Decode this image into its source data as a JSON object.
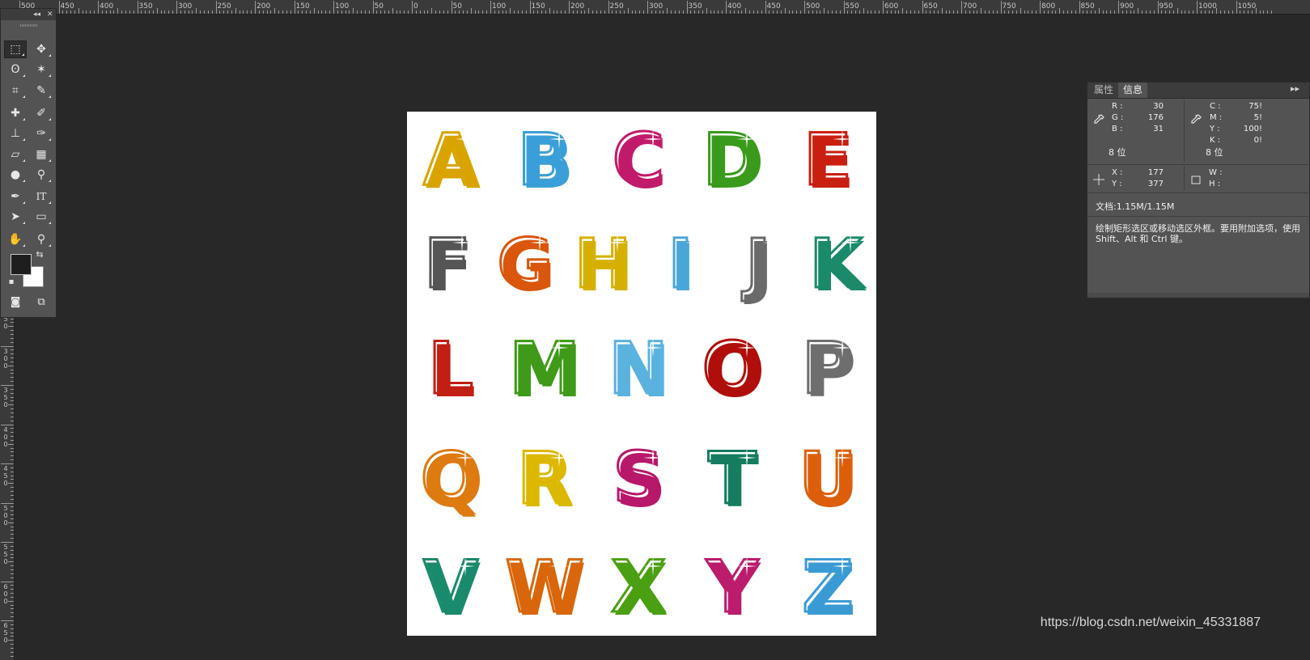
{
  "ruler_top": {
    "labels": [
      "500",
      "450",
      "400",
      "350",
      "300",
      "250",
      "200",
      "150",
      "100",
      "50",
      "0",
      "50",
      "100",
      "150",
      "200",
      "250",
      "300",
      "350",
      "400",
      "450",
      "500",
      "550",
      "600",
      "650",
      "700",
      "750",
      "800",
      "850",
      "900",
      "950",
      "1000",
      "1050"
    ]
  },
  "ruler_left": {
    "labels": [
      "250",
      "300",
      "350",
      "400",
      "450",
      "500",
      "550",
      "600",
      "650"
    ]
  },
  "toolbox": {
    "collapse_glyph": "◂◂",
    "close_glyph": "✕",
    "tools": [
      {
        "name": "rectangular-marquee-tool",
        "glyph": "⬚",
        "active": true
      },
      {
        "name": "move-tool",
        "glyph": "✥"
      },
      {
        "name": "lasso-tool",
        "glyph": "ʘ"
      },
      {
        "name": "magic-wand-tool",
        "glyph": "✶"
      },
      {
        "name": "crop-tool",
        "glyph": "⌗"
      },
      {
        "name": "eyedropper-tool",
        "glyph": "✎"
      },
      {
        "name": "healing-brush-tool",
        "glyph": "✚"
      },
      {
        "name": "brush-tool",
        "glyph": "✐"
      },
      {
        "name": "clone-stamp-tool",
        "glyph": "⊥"
      },
      {
        "name": "history-brush-tool",
        "glyph": "✑"
      },
      {
        "name": "eraser-tool",
        "glyph": "▱"
      },
      {
        "name": "gradient-tool",
        "glyph": "▦"
      },
      {
        "name": "blur-tool",
        "glyph": "●"
      },
      {
        "name": "dodge-tool",
        "glyph": "⚲"
      },
      {
        "name": "pen-tool",
        "glyph": "✒"
      },
      {
        "name": "type-tool",
        "glyph": "IT"
      },
      {
        "name": "path-selection-tool",
        "glyph": "➤"
      },
      {
        "name": "rectangle-tool",
        "glyph": "▭"
      },
      {
        "name": "hand-tool",
        "glyph": "✋"
      },
      {
        "name": "zoom-tool",
        "glyph": "⚲"
      }
    ],
    "foreground_color": "#1e1e1e",
    "background_color": "#ffffff",
    "swap_glyph": "⇆",
    "mask_glyph": "◙",
    "screen_mode_glyph": "⧉"
  },
  "canvas": {
    "background": "#ffffff",
    "letters": [
      {
        "char": "A",
        "c1": "#ffe600",
        "c2": "#f2c300",
        "c3": "#d9a400"
      },
      {
        "char": "B",
        "c1": "#bfe7ff",
        "c2": "#5cbdf0",
        "c3": "#3a9fd8"
      },
      {
        "char": "C",
        "c1": "#ff8fc4",
        "c2": "#e8358a",
        "c3": "#c21a6b"
      },
      {
        "char": "D",
        "c1": "#a7e85c",
        "c2": "#58c22a",
        "c3": "#3a9a1b"
      },
      {
        "char": "E",
        "c1": "#ff9a2e",
        "c2": "#ee3b1a",
        "c3": "#c91f10"
      },
      {
        "char": "F",
        "c1": "#e6e6e6",
        "c2": "#9a9a9a",
        "c3": "#555555"
      },
      {
        "char": "G",
        "c1": "#ffc23a",
        "c2": "#f08a1a",
        "c3": "#d9560c"
      },
      {
        "char": "H",
        "c1": "#fff26a",
        "c2": "#f5d600",
        "c3": "#d6b000"
      },
      {
        "char": "I",
        "c1": "#d6f0ff",
        "c2": "#7cc8f0",
        "c3": "#4aa6d8"
      },
      {
        "char": "J",
        "c1": "#e0e0e0",
        "c2": "#a6a6a6",
        "c3": "#6a6a6a"
      },
      {
        "char": "K",
        "c1": "#9ae8c8",
        "c2": "#2eb08a",
        "c3": "#1a8a6a"
      },
      {
        "char": "L",
        "c1": "#ff9a2a",
        "c2": "#e8321e",
        "c3": "#c11e14"
      },
      {
        "char": "M",
        "c1": "#b2ec5a",
        "c2": "#5ec228",
        "c3": "#3e9a18"
      },
      {
        "char": "N",
        "c1": "#e4f5ff",
        "c2": "#8fd0f2",
        "c3": "#5ab2de"
      },
      {
        "char": "O",
        "c1": "#ff5a3a",
        "c2": "#dd1a12",
        "c3": "#b00e0a"
      },
      {
        "char": "P",
        "c1": "#f0f0f0",
        "c2": "#b0b0b0",
        "c3": "#6e6e6e"
      },
      {
        "char": "Q",
        "c1": "#ffd070",
        "c2": "#f4a020",
        "c3": "#dd7a10"
      },
      {
        "char": "R",
        "c1": "#fff37a",
        "c2": "#f7d810",
        "c3": "#dcb800"
      },
      {
        "char": "S",
        "c1": "#ff96c8",
        "c2": "#e42f88",
        "c3": "#b8186a"
      },
      {
        "char": "T",
        "c1": "#7fdcbc",
        "c2": "#22a07e",
        "c3": "#157c60"
      },
      {
        "char": "U",
        "c1": "#ffca3a",
        "c2": "#f28c12",
        "c3": "#dd5e0a"
      },
      {
        "char": "V",
        "c1": "#9fe6cc",
        "c2": "#34b28e",
        "c3": "#1a8a6c"
      },
      {
        "char": "W",
        "c1": "#ffc636",
        "c2": "#f29414",
        "c3": "#d9660a"
      },
      {
        "char": "X",
        "c1": "#c8f05a",
        "c2": "#6cc81e",
        "c3": "#4aa012"
      },
      {
        "char": "Y",
        "c1": "#ff9cc8",
        "c2": "#e6348a",
        "c3": "#bc1c6c"
      },
      {
        "char": "Z",
        "c1": "#d6f0ff",
        "c2": "#62bdee",
        "c3": "#3a9bd4"
      }
    ]
  },
  "info_panel": {
    "tabs": [
      {
        "label": "属性",
        "active": false
      },
      {
        "label": "信息",
        "active": true
      }
    ],
    "menu_glyph": "▸▸",
    "rgb": {
      "r_label": "R :",
      "r_value": "30",
      "g_label": "G :",
      "g_value": "176",
      "b_label": "B :",
      "b_value": "31",
      "depth": "8 位"
    },
    "cmyk": {
      "c_label": "C :",
      "c_value": "75!",
      "m_label": "M :",
      "m_value": "5!",
      "y_label": "Y :",
      "y_value": "100!",
      "k_label": "K :",
      "k_value": "0!",
      "depth": "8 位"
    },
    "position": {
      "x_label": "X :",
      "x_value": "177",
      "y_label": "Y :",
      "y_value": "377"
    },
    "size": {
      "w_label": "W :",
      "w_value": "",
      "h_label": "H :",
      "h_value": ""
    },
    "document": "文档:1.15M/1.15M",
    "status": "绘制矩形选区或移动选区外框。要用附加选项，使用 Shift、Alt 和 Ctrl 键。"
  },
  "watermark": "https://blog.csdn.net/weixin_45331887"
}
